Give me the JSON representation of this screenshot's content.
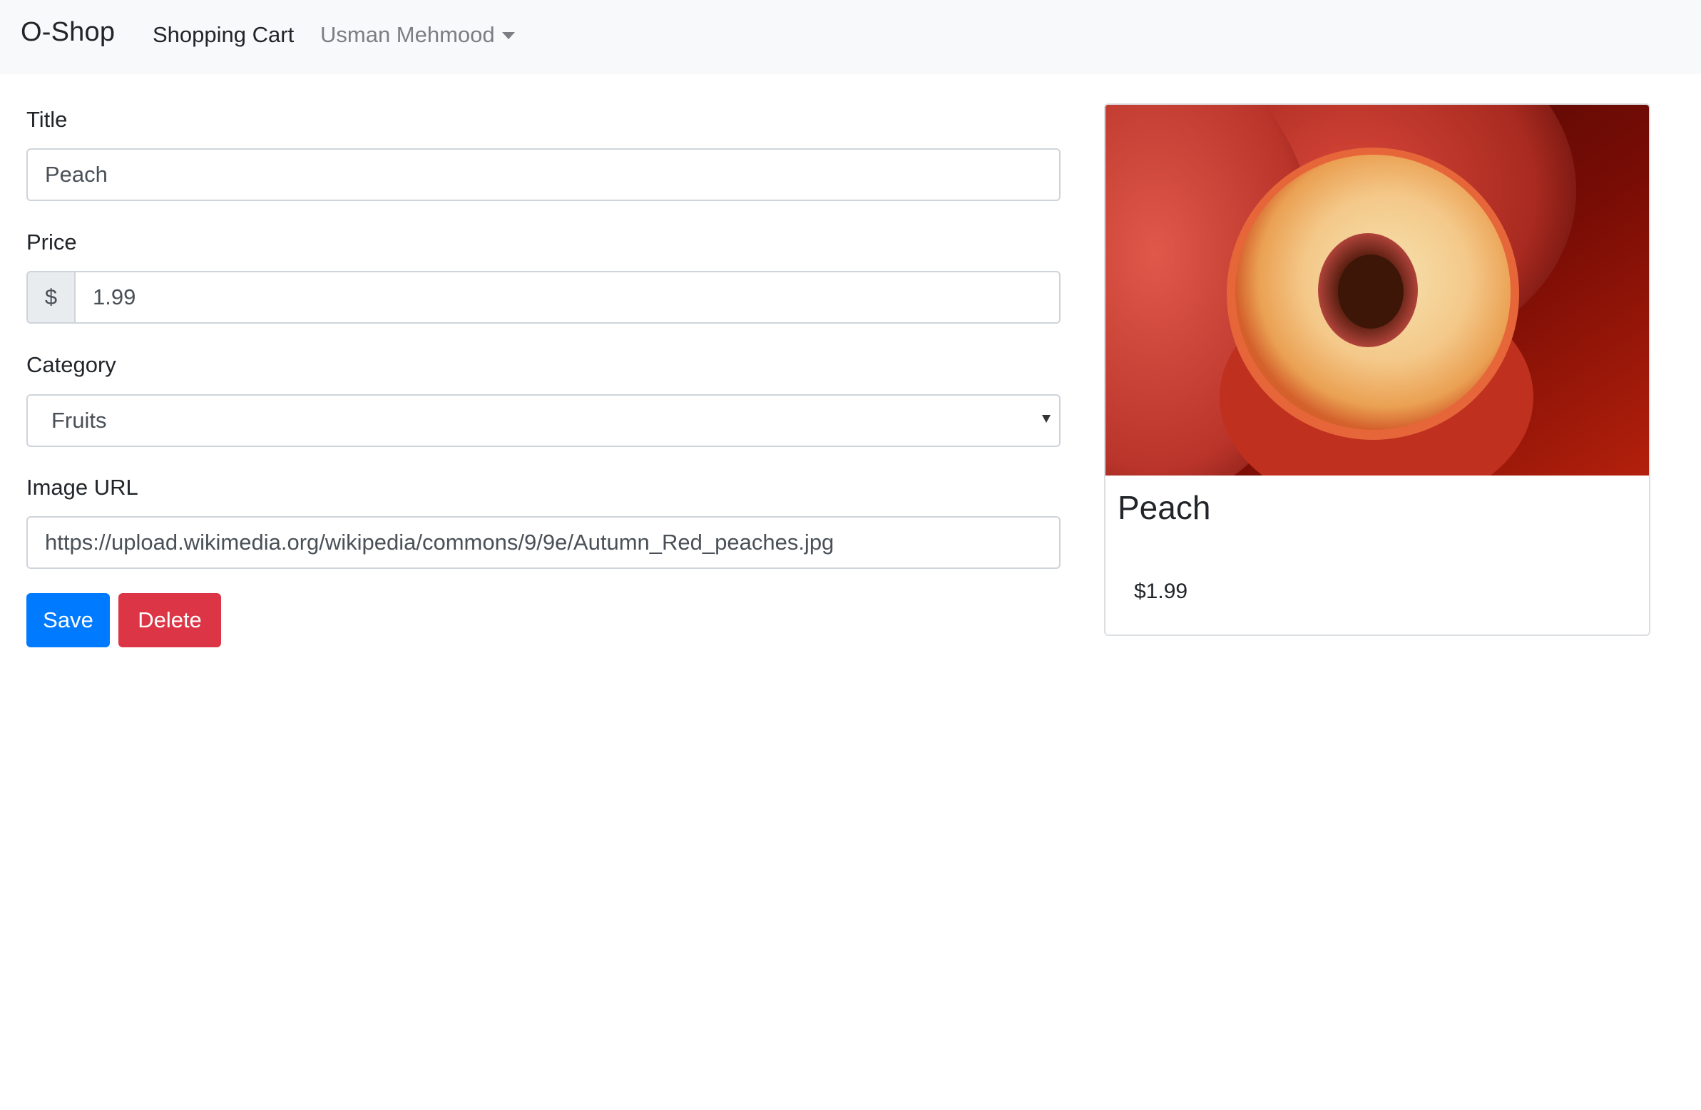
{
  "navbar": {
    "brand": "O-Shop",
    "cart_link": "Shopping Cart",
    "user_menu": "Usman Mehmood"
  },
  "form": {
    "title_label": "Title",
    "title_value": "Peach",
    "price_label": "Price",
    "price_currency": "$",
    "price_value": "1.99",
    "category_label": "Category",
    "category_value": "Fruits",
    "image_label": "Image URL",
    "image_value": "https://upload.wikimedia.org/wikipedia/commons/9/9e/Autumn_Red_peaches.jpg",
    "save_label": "Save",
    "delete_label": "Delete"
  },
  "preview": {
    "title": "Peach",
    "price": "$1.99"
  },
  "colors": {
    "navbar_bg": "#f8f9fa",
    "primary": "#007bff",
    "danger": "#dc3545",
    "muted_link": "#7b7f84"
  },
  "icons": {
    "user_menu_toggle": "caret-down-icon",
    "select_toggle": "dropdown-arrow-icon"
  }
}
